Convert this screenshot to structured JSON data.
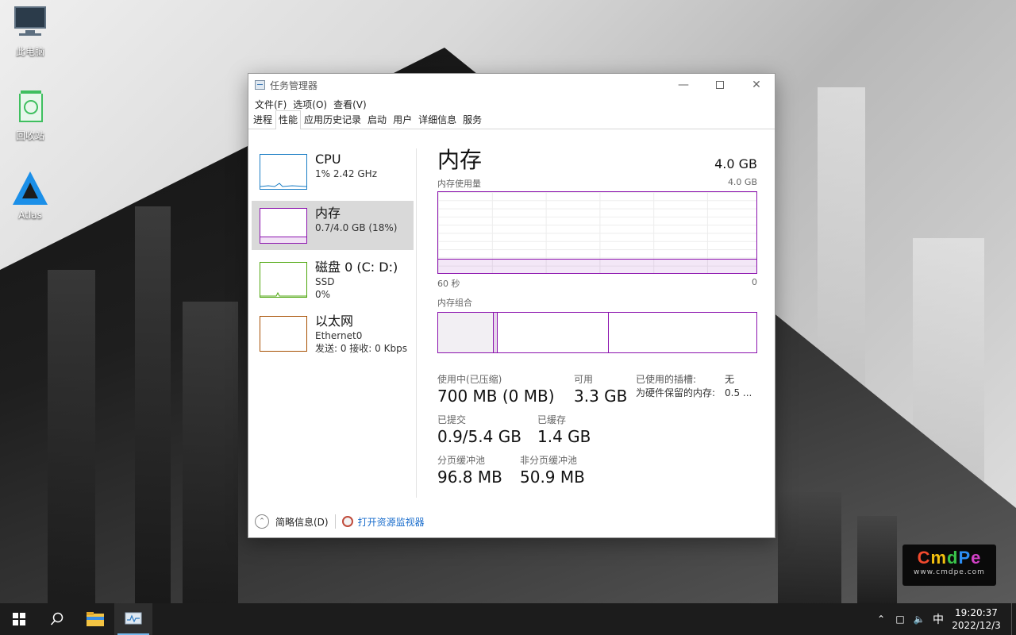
{
  "desktop": {
    "icons": [
      {
        "label": "此电脑",
        "icon": "computer-icon"
      },
      {
        "label": "回收站",
        "icon": "recycle-bin-icon"
      },
      {
        "label": "Atlas",
        "icon": "atlas-logo-icon"
      }
    ]
  },
  "window": {
    "title": "任务管理器",
    "menu": [
      "文件(F)",
      "选项(O)",
      "查看(V)"
    ],
    "tabs": [
      {
        "label": "进程",
        "active": false
      },
      {
        "label": "性能",
        "active": true
      },
      {
        "label": "应用历史记录",
        "active": false
      },
      {
        "label": "启动",
        "active": false
      },
      {
        "label": "用户",
        "active": false
      },
      {
        "label": "详细信息",
        "active": false
      },
      {
        "label": "服务",
        "active": false
      }
    ],
    "sidebar": [
      {
        "name": "CPU",
        "line1": "1%  2.42 GHz",
        "line2": "",
        "color": "#1a7dc5",
        "selected": false
      },
      {
        "name": "内存",
        "line1": "0.7/4.0 GB (18%)",
        "line2": "",
        "color": "#8b12ae",
        "selected": true
      },
      {
        "name": "磁盘 0 (C: D:)",
        "line1": "SSD",
        "line2": "0%",
        "color": "#4da60c",
        "selected": false
      },
      {
        "name": "以太网",
        "line1": "Ethernet0",
        "line2": "发送: 0  接收: 0 Kbps",
        "color": "#a74f01",
        "selected": false
      }
    ],
    "main": {
      "title": "内存",
      "total": "4.0 GB",
      "usage_label": "内存使用量",
      "usage_max": "4.0 GB",
      "usage_fraction": 0.18,
      "axis_left": "60 秒",
      "axis_right": "0",
      "composition_label": "内存组合",
      "stats": {
        "in_use_label": "使用中(已压缩)",
        "in_use_value": "700 MB (0 MB)",
        "available_label": "可用",
        "available_value": "3.3 GB",
        "slots_label": "已使用的插槽:",
        "slots_value": "无",
        "reserved_label": "为硬件保留的内存:",
        "reserved_value": "0.5 ...",
        "committed_label": "已提交",
        "committed_value": "0.9/5.4 GB",
        "cached_label": "已缓存",
        "cached_value": "1.4 GB",
        "paged_label": "分页缓冲池",
        "paged_value": "96.8 MB",
        "nonpaged_label": "非分页缓冲池",
        "nonpaged_value": "50.9 MB"
      }
    },
    "footer": {
      "fewer_details": "简略信息(D)",
      "open_monitor": "打开资源监视器"
    }
  },
  "watermark": {
    "letters": [
      "C",
      "m",
      "d",
      "P",
      "e"
    ],
    "url": "www.cmdpe.com"
  },
  "taskbar": {
    "ime": "中",
    "time": "19:20:37",
    "date": "2022/12/3"
  }
}
